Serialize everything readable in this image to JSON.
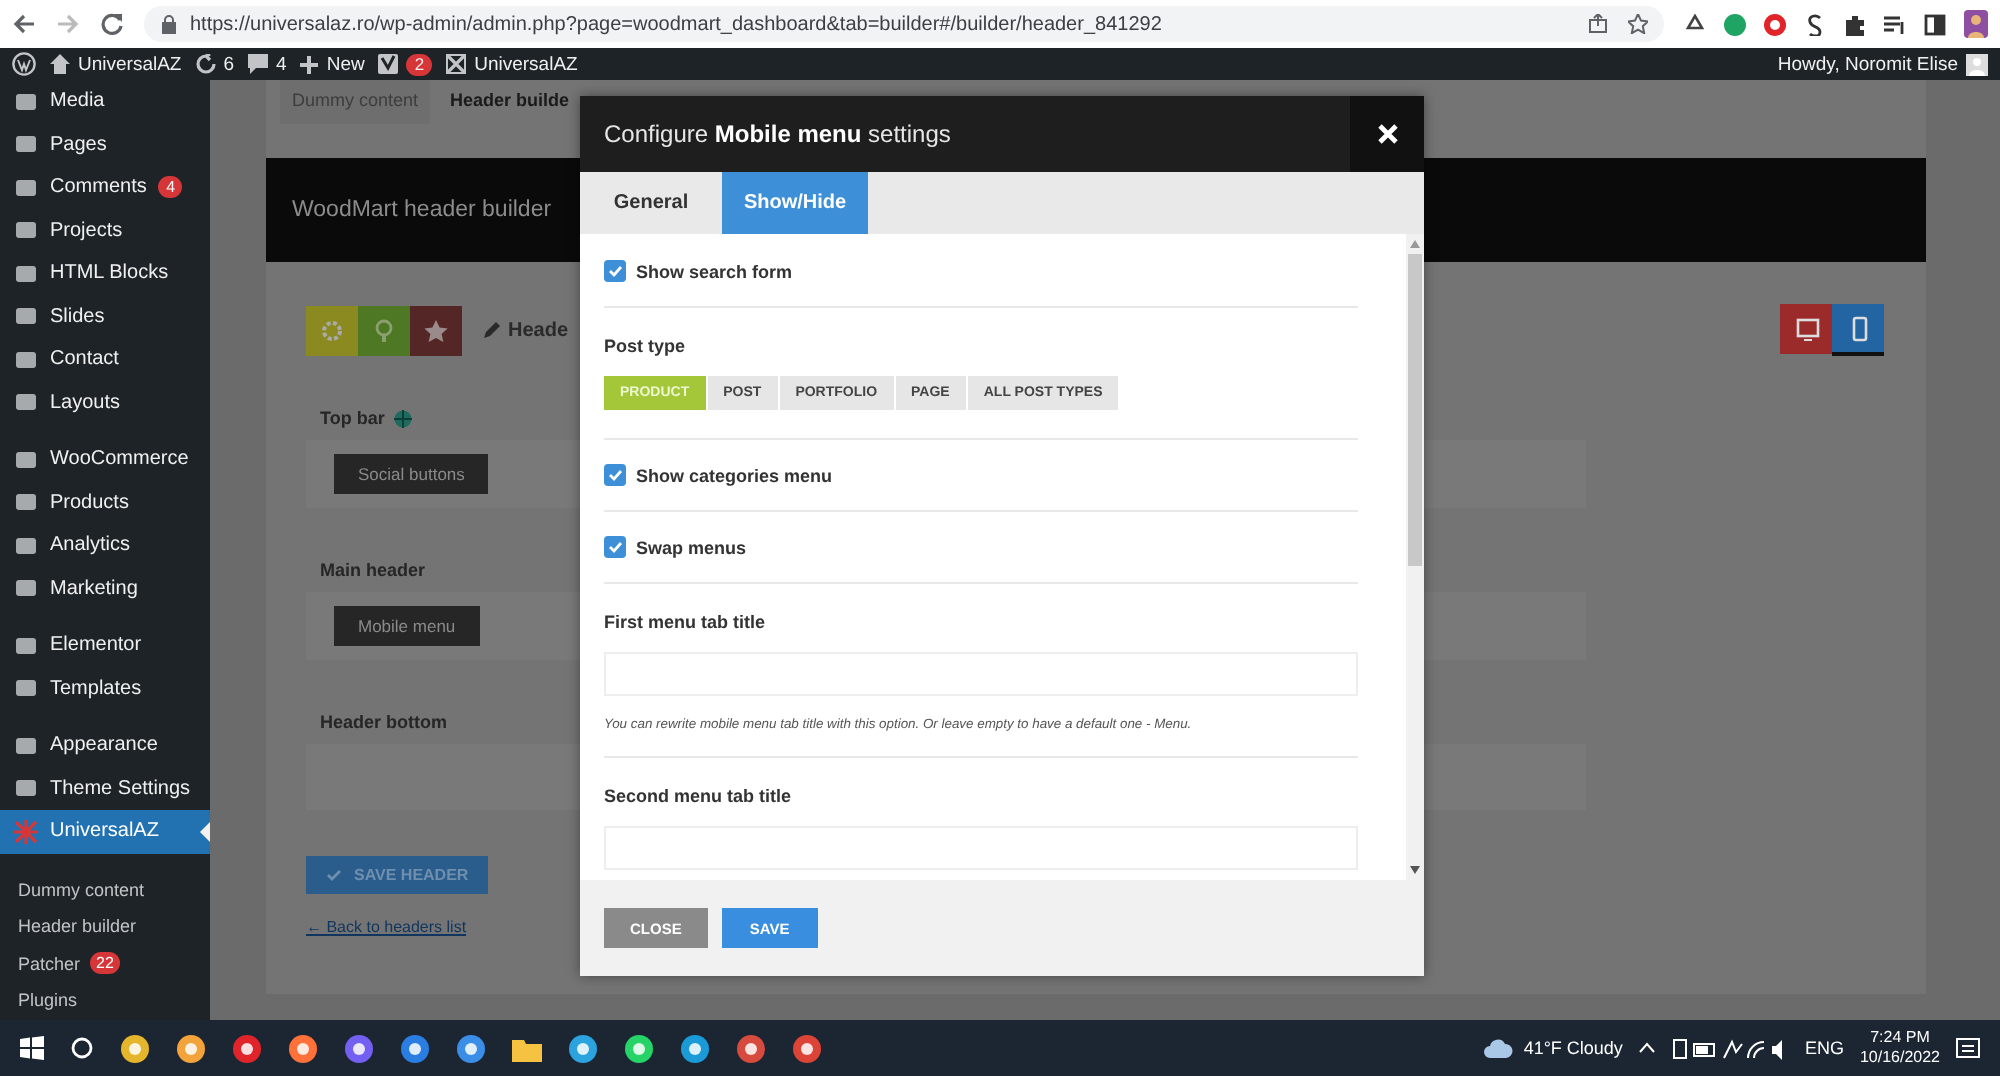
{
  "browser": {
    "url": "https://universalaz.ro/wp-admin/admin.php?page=woodmart_dashboard&tab=builder#/builder/header_841292"
  },
  "admin_bar": {
    "site_name": "UniversalAZ",
    "updates": "6",
    "comments": "4",
    "new_label": "New",
    "notifications": "2",
    "theme_link": "UniversalAZ",
    "greeting": "Howdy, Noromit Elise"
  },
  "sidebar": {
    "groups": [
      {
        "items": [
          {
            "label": "Media",
            "selected": false
          },
          {
            "label": "Pages",
            "selected": false
          },
          {
            "label": "Comments",
            "badge": "4",
            "selected": false
          },
          {
            "label": "Projects",
            "selected": false
          },
          {
            "label": "HTML Blocks",
            "selected": false
          },
          {
            "label": "Slides",
            "selected": false
          },
          {
            "label": "Contact",
            "selected": false
          },
          {
            "label": "Layouts",
            "selected": false
          }
        ]
      },
      {
        "items": [
          {
            "label": "WooCommerce",
            "selected": false
          },
          {
            "label": "Products",
            "selected": false
          },
          {
            "label": "Analytics",
            "selected": false
          },
          {
            "label": "Marketing",
            "selected": false
          }
        ]
      },
      {
        "items": [
          {
            "label": "Elementor",
            "selected": false
          },
          {
            "label": "Templates",
            "selected": false
          }
        ]
      },
      {
        "items": [
          {
            "label": "Appearance",
            "selected": false
          },
          {
            "label": "Theme Settings",
            "selected": false
          },
          {
            "label": "UniversalAZ",
            "selected": true
          }
        ]
      }
    ],
    "submenu": [
      {
        "label": "Dummy content"
      },
      {
        "label": "Header builder"
      },
      {
        "label": "Patcher",
        "badge": "22"
      },
      {
        "label": "Plugins"
      }
    ]
  },
  "builder": {
    "tabs": [
      {
        "label": "Dummy content",
        "selected": false
      },
      {
        "label": "Header builde",
        "selected": true
      }
    ],
    "banner": "WoodMart header builder",
    "header_name": "Heade",
    "devices": [
      {
        "kind": "desktop",
        "selected": false
      },
      {
        "kind": "mobile",
        "selected": true
      }
    ],
    "rows": [
      {
        "label": "Top bar",
        "icon": true,
        "elements": [
          "Social buttons"
        ]
      },
      {
        "label": "Main header",
        "icon": false,
        "elements": [
          "Mobile menu"
        ]
      },
      {
        "label": "Header bottom",
        "icon": false
      }
    ],
    "save_button": "SAVE HEADER",
    "back_link": "← Back to headers list"
  },
  "modal": {
    "title": "Configure **Mobile menu** settings",
    "tabs": [
      {
        "label": "General",
        "selected": false
      },
      {
        "label": "Show/Hide",
        "selected": true
      }
    ],
    "fields": [
      {
        "kind": "checkbox",
        "label": "Show search form",
        "checked": true
      },
      {
        "kind": "choice",
        "label": "Post type",
        "options": [
          {
            "label": "PRODUCT",
            "selected": true
          },
          {
            "label": "POST",
            "selected": false
          },
          {
            "label": "PORTFOLIO",
            "selected": false
          },
          {
            "label": "PAGE",
            "selected": false
          },
          {
            "label": "ALL POST TYPES",
            "selected": false
          }
        ]
      },
      {
        "kind": "checkbox",
        "label": "Show categories menu",
        "checked": true
      },
      {
        "kind": "checkbox",
        "label": "Swap menus",
        "checked": true
      },
      {
        "kind": "text",
        "label": "First menu tab title",
        "hint": "You can rewrite mobile menu tab title with this option. Or leave empty to have a default one - Menu."
      },
      {
        "kind": "text",
        "label": "Second menu tab title"
      }
    ],
    "buttons": [
      {
        "kind": "close",
        "label": "CLOSE"
      },
      {
        "kind": "save",
        "label": "SAVE"
      }
    ]
  },
  "taskbar": {
    "weather": "41°F Cloudy",
    "language": "ENG",
    "time": "7:24 PM",
    "date": "10/16/2022"
  }
}
